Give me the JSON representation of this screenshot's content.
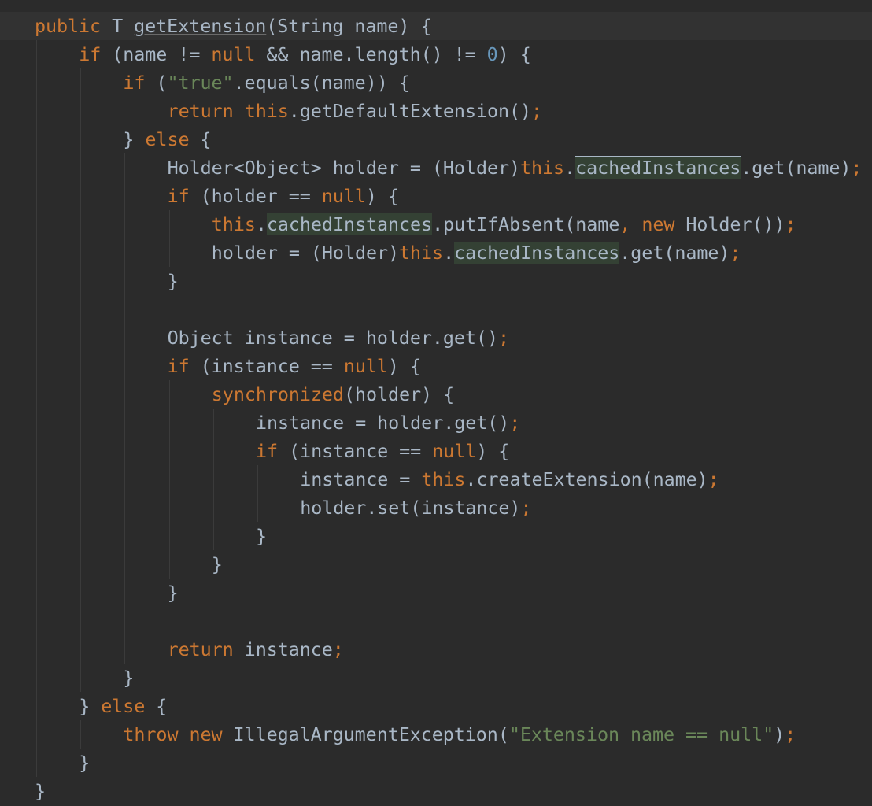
{
  "editor": {
    "language": "java",
    "colors": {
      "background": "#2b2b2b",
      "caret_line": "#323232",
      "keyword": "#cc7832",
      "identifier": "#a9b7c6",
      "string": "#6a8759",
      "number": "#6897bb",
      "usage_highlight": "#344134"
    },
    "lines": [
      {
        "indent": 0,
        "tokens": [
          [
            "kw",
            "public"
          ],
          [
            "plain",
            " T "
          ],
          [
            "under",
            "getExtension"
          ],
          [
            "plain",
            "(String name) {"
          ]
        ]
      },
      {
        "indent": 1,
        "tokens": [
          [
            "kw",
            "if"
          ],
          [
            "plain",
            " (name != "
          ],
          [
            "kw",
            "null"
          ],
          [
            "plain",
            " && name.length() != "
          ],
          [
            "num",
            "0"
          ],
          [
            "plain",
            ") {"
          ]
        ]
      },
      {
        "indent": 2,
        "tokens": [
          [
            "kw",
            "if"
          ],
          [
            "plain",
            " ("
          ],
          [
            "str",
            "\"true\""
          ],
          [
            "plain",
            ".equals(name)) {"
          ]
        ]
      },
      {
        "indent": 3,
        "tokens": [
          [
            "kw",
            "return"
          ],
          [
            "plain",
            " "
          ],
          [
            "kw",
            "this"
          ],
          [
            "plain",
            ".getDefaultExtension()"
          ],
          [
            "punc",
            ";"
          ]
        ]
      },
      {
        "indent": 2,
        "tokens": [
          [
            "plain",
            "} "
          ],
          [
            "kw",
            "else"
          ],
          [
            "plain",
            " {"
          ]
        ]
      },
      {
        "indent": 3,
        "tokens": [
          [
            "plain",
            "Holder<Object> holder = (Holder)"
          ],
          [
            "kw",
            "this"
          ],
          [
            "plain",
            "."
          ],
          [
            "hlb",
            "cachedInstances"
          ],
          [
            "plain",
            ".get(name)"
          ],
          [
            "punc",
            ";"
          ]
        ]
      },
      {
        "indent": 3,
        "tokens": [
          [
            "kw",
            "if"
          ],
          [
            "plain",
            " (holder == "
          ],
          [
            "kw",
            "null"
          ],
          [
            "plain",
            ") {"
          ]
        ]
      },
      {
        "indent": 4,
        "tokens": [
          [
            "kw",
            "this"
          ],
          [
            "plain",
            "."
          ],
          [
            "hl",
            "cachedInstances"
          ],
          [
            "plain",
            ".putIfAbsent(name"
          ],
          [
            "punc",
            ","
          ],
          [
            "plain",
            " "
          ],
          [
            "kw",
            "new"
          ],
          [
            "plain",
            " Holder())"
          ],
          [
            "punc",
            ";"
          ]
        ]
      },
      {
        "indent": 4,
        "tokens": [
          [
            "plain",
            "holder = (Holder)"
          ],
          [
            "kw",
            "this"
          ],
          [
            "plain",
            "."
          ],
          [
            "hl",
            "cachedInstances"
          ],
          [
            "plain",
            ".get(name)"
          ],
          [
            "punc",
            ";"
          ]
        ]
      },
      {
        "indent": 3,
        "tokens": [
          [
            "plain",
            "}"
          ]
        ]
      },
      {
        "indent": 0,
        "tokens": []
      },
      {
        "indent": 3,
        "tokens": [
          [
            "plain",
            "Object instance = holder.get()"
          ],
          [
            "punc",
            ";"
          ]
        ]
      },
      {
        "indent": 3,
        "tokens": [
          [
            "kw",
            "if"
          ],
          [
            "plain",
            " (instance == "
          ],
          [
            "kw",
            "null"
          ],
          [
            "plain",
            ") {"
          ]
        ]
      },
      {
        "indent": 4,
        "tokens": [
          [
            "kw",
            "synchronized"
          ],
          [
            "plain",
            "(holder) {"
          ]
        ]
      },
      {
        "indent": 5,
        "tokens": [
          [
            "plain",
            "instance = holder.get()"
          ],
          [
            "punc",
            ";"
          ]
        ]
      },
      {
        "indent": 5,
        "tokens": [
          [
            "kw",
            "if"
          ],
          [
            "plain",
            " (instance == "
          ],
          [
            "kw",
            "null"
          ],
          [
            "plain",
            ") {"
          ]
        ]
      },
      {
        "indent": 6,
        "tokens": [
          [
            "plain",
            "instance = "
          ],
          [
            "kw",
            "this"
          ],
          [
            "plain",
            ".createExtension(name)"
          ],
          [
            "punc",
            ";"
          ]
        ]
      },
      {
        "indent": 6,
        "tokens": [
          [
            "plain",
            "holder.set(instance)"
          ],
          [
            "punc",
            ";"
          ]
        ]
      },
      {
        "indent": 5,
        "tokens": [
          [
            "plain",
            "}"
          ]
        ]
      },
      {
        "indent": 4,
        "tokens": [
          [
            "plain",
            "}"
          ]
        ]
      },
      {
        "indent": 3,
        "tokens": [
          [
            "plain",
            "}"
          ]
        ]
      },
      {
        "indent": 0,
        "tokens": []
      },
      {
        "indent": 3,
        "tokens": [
          [
            "kw",
            "return"
          ],
          [
            "plain",
            " instance"
          ],
          [
            "punc",
            ";"
          ]
        ]
      },
      {
        "indent": 2,
        "tokens": [
          [
            "plain",
            "}"
          ]
        ]
      },
      {
        "indent": 1,
        "tokens": [
          [
            "plain",
            "} "
          ],
          [
            "kw",
            "else"
          ],
          [
            "plain",
            " {"
          ]
        ]
      },
      {
        "indent": 2,
        "tokens": [
          [
            "kw",
            "throw"
          ],
          [
            "plain",
            " "
          ],
          [
            "kw",
            "new"
          ],
          [
            "plain",
            " IllegalArgumentException("
          ],
          [
            "str",
            "\"Extension name == null\""
          ],
          [
            "plain",
            ")"
          ],
          [
            "punc",
            ";"
          ]
        ]
      },
      {
        "indent": 1,
        "tokens": [
          [
            "plain",
            "}"
          ]
        ]
      },
      {
        "indent": 0,
        "tokens": [
          [
            "plain",
            "}"
          ]
        ]
      }
    ]
  }
}
